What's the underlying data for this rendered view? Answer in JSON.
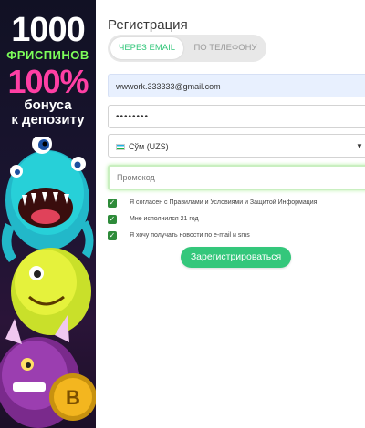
{
  "banner": {
    "line1": "1000",
    "line2": "ФРИСПИНОВ",
    "line3": "100%",
    "line4": "бонуса",
    "line5": "к депозиту"
  },
  "form": {
    "title": "Регистрация",
    "tabs": [
      {
        "label": "ЧЕРЕЗ EMAIL",
        "active": true
      },
      {
        "label": "ПО ТЕЛЕФОНУ",
        "active": false
      }
    ],
    "email_value": "wwwork.333333@gmail.com",
    "password_value": "••••••••",
    "currency": {
      "flag_icon": "uzbekistan-flag-icon",
      "value": "Сўм (UZS)"
    },
    "promo_placeholder": "Промокод",
    "checkboxes": [
      {
        "label": "Я согласен с Правилами и Условиями и Защитой Информация",
        "checked": true
      },
      {
        "label": "Мне исполнился 21 год",
        "checked": true
      },
      {
        "label": "Я хочу получать новости по e-mail и sms",
        "checked": true
      }
    ],
    "submit_label": "Зарегистрироваться"
  },
  "colors": {
    "accent_green": "#34c77b",
    "checkbox_green": "#2e8b3a",
    "email_field_bg": "#e8f0fe",
    "banner_pink": "#ff3fa4",
    "banner_lime": "#7dff5a"
  }
}
